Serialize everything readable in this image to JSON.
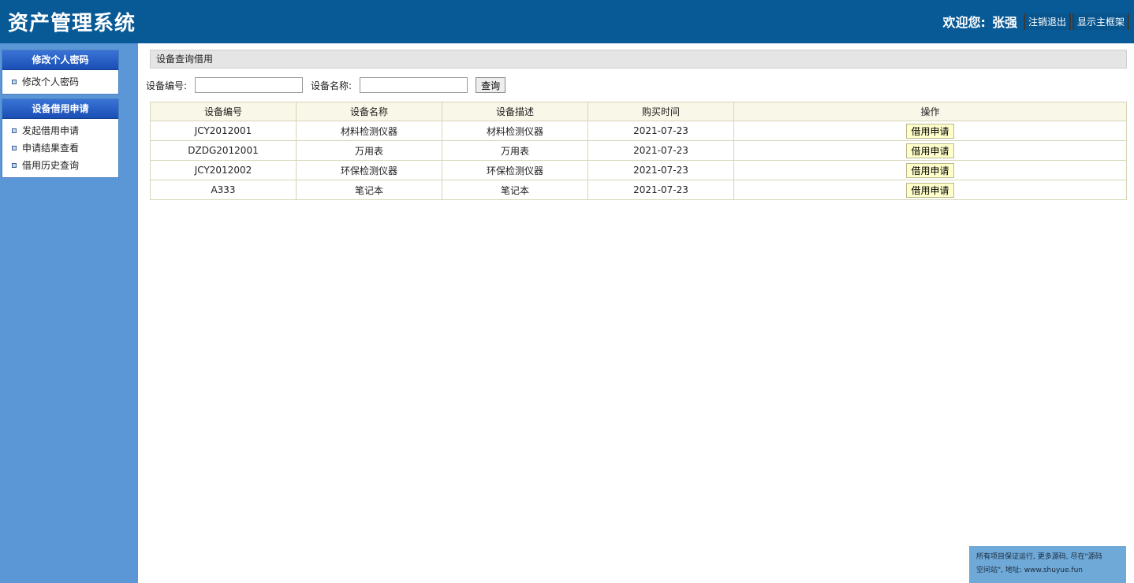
{
  "header": {
    "title": "资产管理系统",
    "welcome_label": "欢迎您:",
    "user_name": "张强",
    "logout_label": "注销退出",
    "show_frame_label": "显示主框架"
  },
  "sidebar": {
    "groups": [
      {
        "title": "修改个人密码",
        "items": [
          {
            "label": "修改个人密码"
          }
        ]
      },
      {
        "title": "设备借用申请",
        "items": [
          {
            "label": "发起借用申请"
          },
          {
            "label": "申请结果查看"
          },
          {
            "label": "借用历史查询"
          }
        ]
      }
    ]
  },
  "main": {
    "breadcrumb": "设备查询借用",
    "search": {
      "id_label": "设备编号:",
      "id_value": "",
      "name_label": "设备名称:",
      "name_value": "",
      "query_label": "查询"
    },
    "table": {
      "headers": [
        "设备编号",
        "设备名称",
        "设备描述",
        "购买时间",
        "操作"
      ],
      "rows": [
        {
          "id": "JCY2012001",
          "name": "材料检测仪器",
          "desc": "材料检测仪器",
          "date": "2021-07-23",
          "action": "借用申请"
        },
        {
          "id": "DZDG2012001",
          "name": "万用表",
          "desc": "万用表",
          "date": "2021-07-23",
          "action": "借用申请"
        },
        {
          "id": "JCY2012002",
          "name": "环保检测仪器",
          "desc": "环保检测仪器",
          "date": "2021-07-23",
          "action": "借用申请"
        },
        {
          "id": "A333",
          "name": "笔记本",
          "desc": "笔记本",
          "date": "2021-07-23",
          "action": "借用申请"
        }
      ]
    }
  },
  "notice": {
    "line1": "所有项目保证运行, 更多源码, 尽在\"源码",
    "line2": "空间站\", 地址: www.shuyue.fun"
  },
  "colors": {
    "header_bg": "#085A96",
    "sidebar_bg": "#5B97D7",
    "table_border": "#D7D5B6",
    "action_button_bg": "#FFFFCC"
  }
}
